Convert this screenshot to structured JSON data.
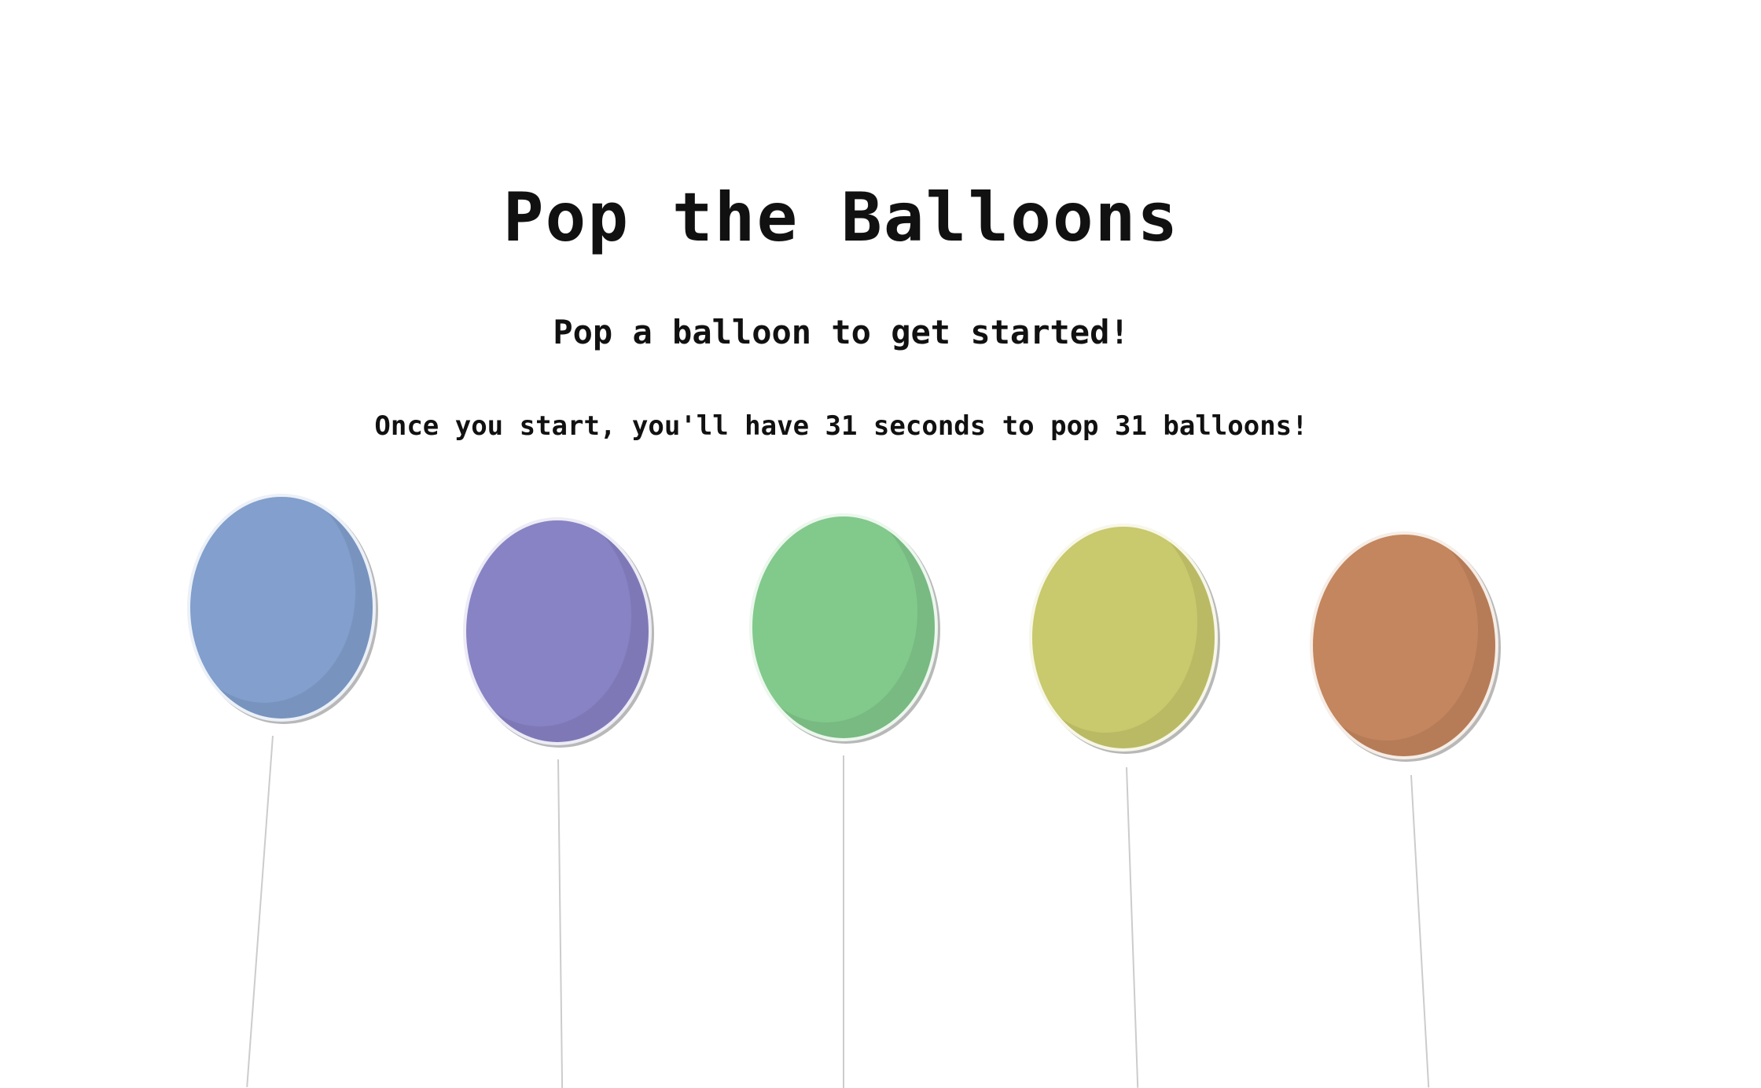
{
  "game": {
    "title": "Pop the Balloons",
    "subtitle": "Pop a balloon to get started!",
    "instructions": "Once you start, you'll have 31 seconds to pop 31 balloons!"
  },
  "balloons": [
    {
      "color": "#829fcd",
      "string_color": "#cccccc"
    },
    {
      "color": "#8883c4",
      "string_color": "#cccccc"
    },
    {
      "color": "#82c98c",
      "string_color": "#cccccc"
    },
    {
      "color": "#c9c96d",
      "string_color": "#cccccc"
    },
    {
      "color": "#c4865e",
      "string_color": "#cccccc"
    }
  ]
}
